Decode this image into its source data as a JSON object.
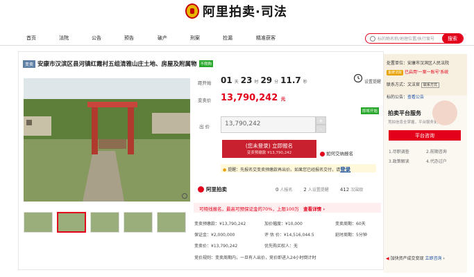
{
  "brand": {
    "name": "阿里拍卖·司法"
  },
  "nav": [
    "首页",
    "法院",
    "公告",
    "预告",
    "破产",
    "刑案",
    "捡漏",
    "精准获客"
  ],
  "search": {
    "placeholder": "标的物名称/地理位置/执行案号",
    "button": "搜索"
  },
  "item": {
    "tag": "变卖",
    "title": "安康市汉滨区县河镇红霞村五组清雅山庄土地、房屋及附属物",
    "tag2": "不限购"
  },
  "countdown": {
    "label": "距开始",
    "days": "01",
    "d_unit": "天",
    "hours": "23",
    "h_unit": "时",
    "minutes": "29",
    "m_unit": "分",
    "seconds": "11.7",
    "s_unit": "秒"
  },
  "remind": "设置提醒",
  "price": {
    "label": "变卖价",
    "value": "13,790,242",
    "unit": "元"
  },
  "bid": {
    "label": "出 价",
    "value": "13,790,242",
    "badge": "即将开始",
    "plus": "+",
    "minus": "-"
  },
  "apply": {
    "line1": "(您未登录) 立即报名",
    "line2": "变卖预缴款 ¥13,790,242"
  },
  "howto": "如何交纳报名",
  "notice": {
    "text": "提醒：先报名交变卖预缴款再出价。如果您已经报名交付，请",
    "link": "登录"
  },
  "stats": {
    "brand": "阿里拍卖",
    "signup": "0",
    "signup_label": "人报名",
    "reminders": "2",
    "reminders_label": "人设置提醒",
    "views": "412",
    "views_label": "次围观"
  },
  "loan": {
    "text": "可特线报名，最高可预保证金的70%，上限100万",
    "link": "查看详情 ›"
  },
  "info": {
    "deposit": "变卖预缴款：¥13,790,242",
    "bond": "保证金：¥2,000,000",
    "sale_price": "变卖价：¥13,790,242",
    "increment": "加价幅度：¥10,000",
    "assess": "评 估 价：¥14,516,044.5",
    "priority": "优先购买权人：无",
    "period": "变卖周期：60天",
    "delay": "延时周期：5分钟",
    "rule": "竞价规则：变卖周期内，一旦有人出价，竞价即进入24小时倒计时"
  },
  "sidebar": {
    "court_label": "处置单位：",
    "court": "安康市汉滨区人民法院",
    "court_badge": "金牌法院",
    "court_tip": "已启用'一案一账号'系统",
    "contact_label": "联系方式：",
    "contact": "文法官",
    "contact_btn": "联系方式",
    "notice_label": "标的公告：",
    "notice_link": "查看公告",
    "svc_title": "拍卖平台服务",
    "svc_sub": "竞拍信息全掌握，平台服务更放心",
    "svc_btn": "平台咨询",
    "links": [
      "1.尽职调查",
      "2.前期咨询",
      "3.政策解读",
      "4.代办过户"
    ],
    "bottom_text": "加快资产成交变现",
    "bottom_link": "立即咨询"
  }
}
